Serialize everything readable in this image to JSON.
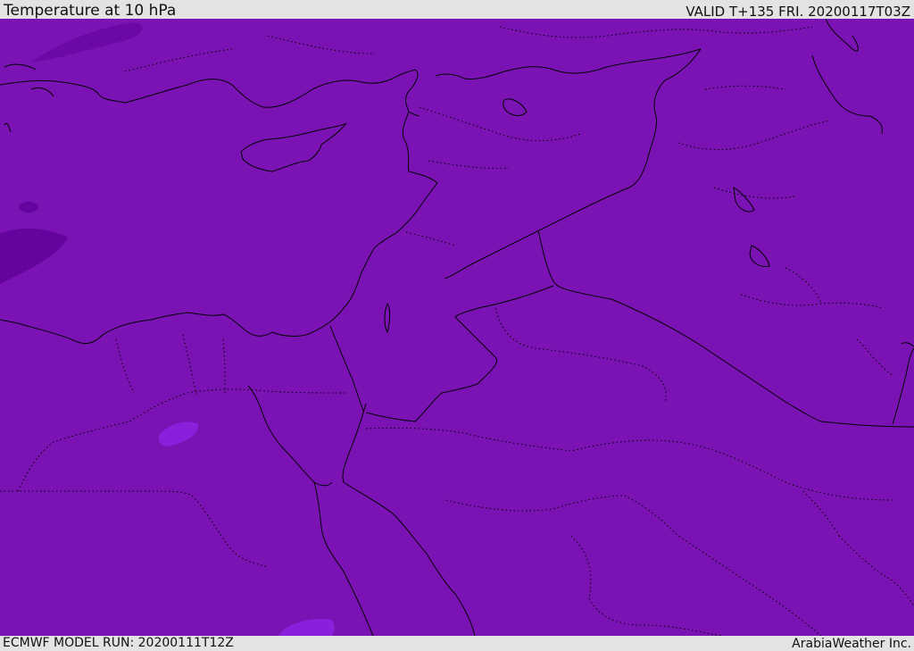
{
  "header": {
    "title": "Temperature at 10 hPa",
    "valid_time": "VALID T+135 FRI. 20200117T03Z"
  },
  "footer": {
    "model_run": "ECMWF MODEL RUN: 20200111T12Z",
    "credit": "ArabiaWeather Inc."
  },
  "map": {
    "field_color": "#7a12b4",
    "cold_patch_color": "#64049c",
    "warm_patch_color": "#8a1fdc",
    "coastline_color": "#000000",
    "border_style": "dotted"
  }
}
